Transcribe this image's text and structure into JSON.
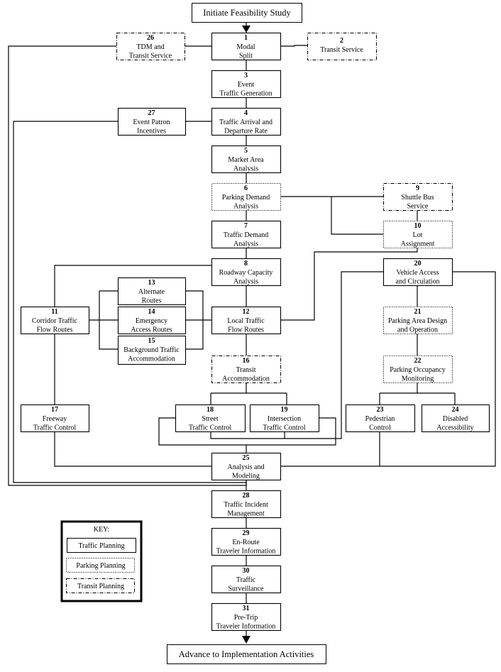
{
  "start_label": "Initiate Feasibility Study",
  "end_label": "Advance to Implementation Activities",
  "key": {
    "title": "KEY:",
    "items": [
      {
        "label": "Traffic Planning",
        "style": "traffic"
      },
      {
        "label": "Parking Planning",
        "style": "parking"
      },
      {
        "label": "Transit Planning",
        "style": "transit"
      }
    ]
  },
  "boxes": [
    {
      "id": "1",
      "lines": [
        "Modal",
        "Split"
      ],
      "style": "traffic"
    },
    {
      "id": "2",
      "lines": [
        "Transit Service"
      ],
      "style": "transit"
    },
    {
      "id": "3",
      "lines": [
        "Event",
        "Traffic Generation"
      ],
      "style": "traffic"
    },
    {
      "id": "4",
      "lines": [
        "Traffic Arrival and",
        "Departure Rate"
      ],
      "style": "traffic"
    },
    {
      "id": "5",
      "lines": [
        "Market Area",
        "Analysis"
      ],
      "style": "traffic"
    },
    {
      "id": "6",
      "lines": [
        "Parking Demand",
        "Analysis"
      ],
      "style": "parking"
    },
    {
      "id": "7",
      "lines": [
        "Traffic Demand",
        "Analysis"
      ],
      "style": "traffic"
    },
    {
      "id": "8",
      "lines": [
        "Roadway Capacity",
        "Analysis"
      ],
      "style": "traffic"
    },
    {
      "id": "9",
      "lines": [
        "Shuttle Bus",
        "Service"
      ],
      "style": "transit"
    },
    {
      "id": "10",
      "lines": [
        "Lot",
        "Assignment"
      ],
      "style": "parking"
    },
    {
      "id": "11",
      "lines": [
        "Corridor Traffic",
        "Flow Routes"
      ],
      "style": "traffic"
    },
    {
      "id": "12",
      "lines": [
        "Local Traffic",
        "Flow Routes"
      ],
      "style": "traffic"
    },
    {
      "id": "13",
      "lines": [
        "Alternate",
        "Routes"
      ],
      "style": "traffic"
    },
    {
      "id": "14",
      "lines": [
        "Emergency",
        "Access Routes"
      ],
      "style": "traffic"
    },
    {
      "id": "15",
      "lines": [
        "Background Traffic",
        "Accommodation"
      ],
      "style": "traffic"
    },
    {
      "id": "16",
      "lines": [
        "Transit",
        "Accommodation"
      ],
      "style": "transit"
    },
    {
      "id": "17",
      "lines": [
        "Freeway",
        "Traffic Control"
      ],
      "style": "traffic"
    },
    {
      "id": "18",
      "lines": [
        "Street",
        "Traffic Control"
      ],
      "style": "traffic"
    },
    {
      "id": "19",
      "lines": [
        "Intersection",
        "Traffic Control"
      ],
      "style": "traffic"
    },
    {
      "id": "20",
      "lines": [
        "Vehicle Access",
        "and Circulation"
      ],
      "style": "traffic"
    },
    {
      "id": "21",
      "lines": [
        "Parking Area Design",
        "and Operation"
      ],
      "style": "parking"
    },
    {
      "id": "22",
      "lines": [
        "Parking Occupancy",
        "Monitoring"
      ],
      "style": "parking"
    },
    {
      "id": "23",
      "lines": [
        "Pedestrian",
        "Control"
      ],
      "style": "traffic"
    },
    {
      "id": "24",
      "lines": [
        "Disabled",
        "Accessibility"
      ],
      "style": "traffic"
    },
    {
      "id": "25",
      "lines": [
        "Analysis and",
        "Modeling"
      ],
      "style": "traffic"
    },
    {
      "id": "26",
      "lines": [
        "TDM and",
        "Transit Service"
      ],
      "style": "transit"
    },
    {
      "id": "27",
      "lines": [
        "Event Patron",
        "Incentives"
      ],
      "style": "traffic"
    },
    {
      "id": "28",
      "lines": [
        "Traffic Incident",
        "Management"
      ],
      "style": "traffic"
    },
    {
      "id": "29",
      "lines": [
        "En-Route",
        "Traveler Information"
      ],
      "style": "traffic"
    },
    {
      "id": "30",
      "lines": [
        "Traffic",
        "Surveillance"
      ],
      "style": "traffic"
    },
    {
      "id": "31",
      "lines": [
        "Pre-Trip",
        "Traveler Information"
      ],
      "style": "traffic"
    }
  ]
}
